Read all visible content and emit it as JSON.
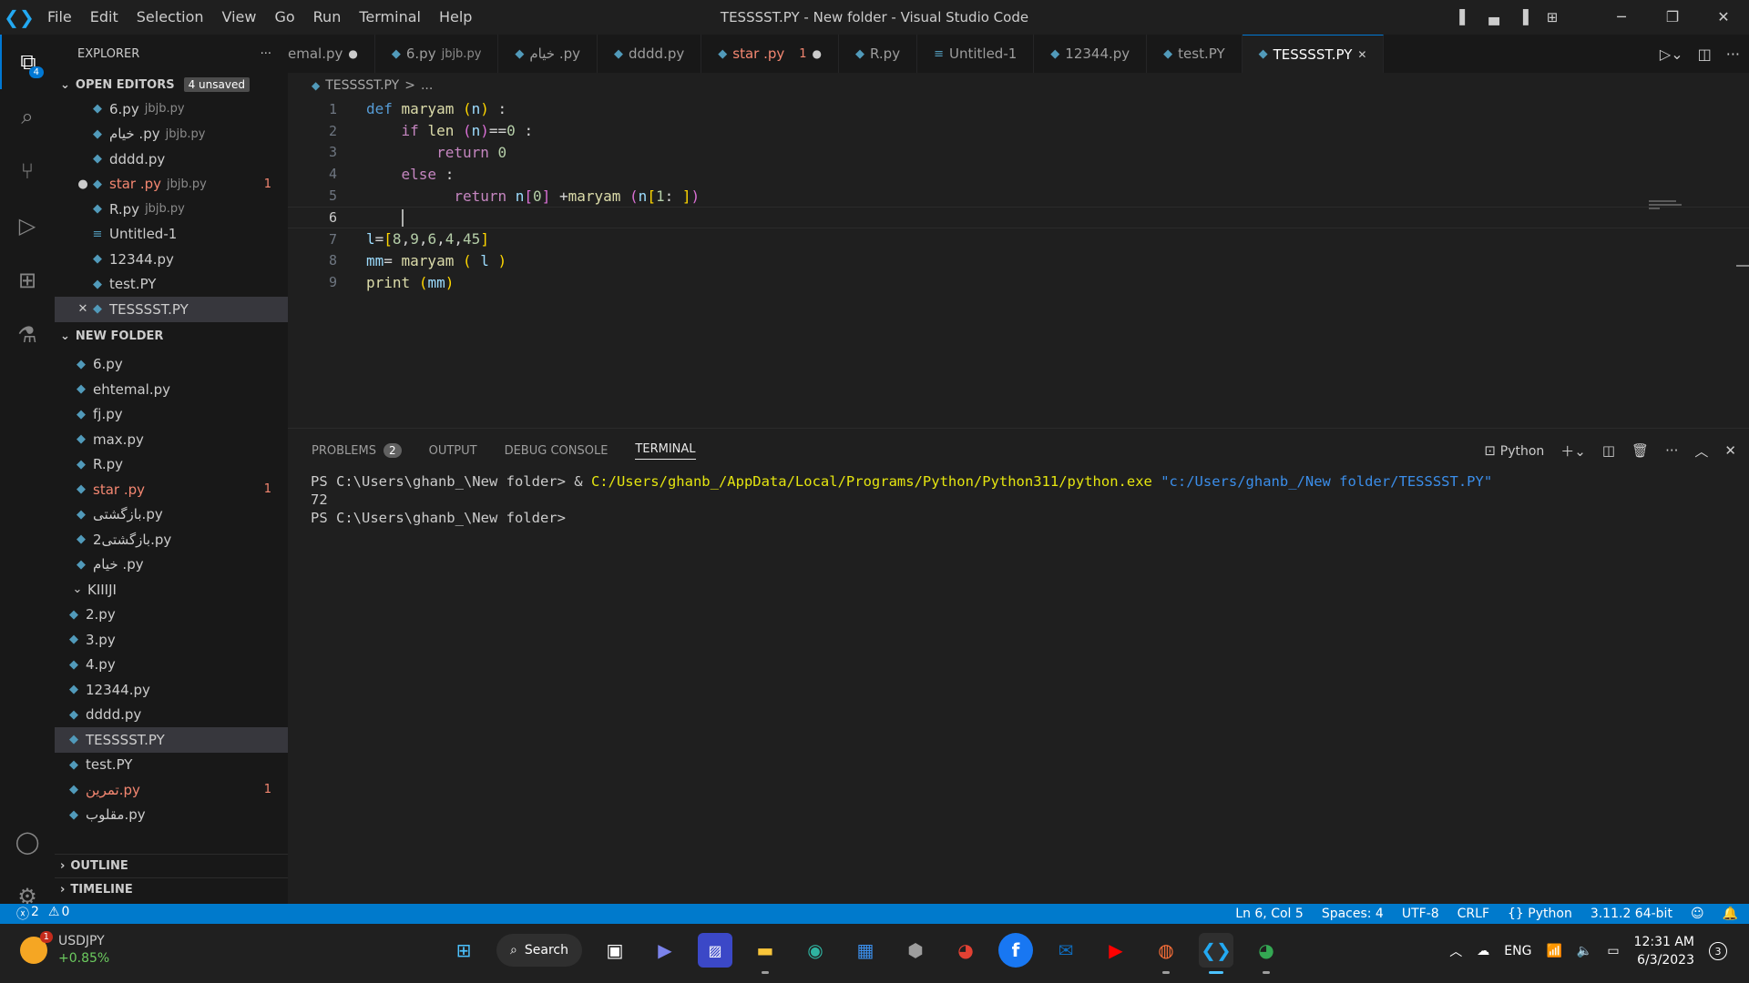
{
  "window": {
    "title": "TESSSST.PY - New folder - Visual Studio Code",
    "menu": [
      "File",
      "Edit",
      "Selection",
      "View",
      "Go",
      "Run",
      "Terminal",
      "Help"
    ]
  },
  "activity_bar": {
    "explorer_badge": "4",
    "items": [
      "files-icon",
      "search-icon",
      "source-control-icon",
      "run-debug-icon",
      "extensions-icon",
      "testing-icon"
    ],
    "bottom": [
      "account-icon",
      "settings-gear-icon"
    ]
  },
  "explorer": {
    "title": "EXPLORER",
    "more": "···",
    "open_editors": {
      "label": "OPEN EDITORS",
      "unsaved": "4 unsaved",
      "items": [
        {
          "name": "6.py",
          "desc": "jbjb.py"
        },
        {
          "name": "خیام .py",
          "desc": "jbjb.py"
        },
        {
          "name": "dddd.py",
          "desc": ""
        },
        {
          "name": "star .py",
          "desc": "jbjb.py",
          "errors": "1"
        },
        {
          "name": "R.py",
          "desc": "jbjb.py"
        },
        {
          "name": "Untitled-1",
          "desc": ""
        },
        {
          "name": "12344.py",
          "desc": ""
        },
        {
          "name": "test.PY",
          "desc": ""
        },
        {
          "name": "TESSSST.PY",
          "desc": ""
        }
      ]
    },
    "folder": {
      "label": "NEW FOLDER",
      "files": [
        {
          "name": "6.py"
        },
        {
          "name": "ehtemal.py"
        },
        {
          "name": "fj.py"
        },
        {
          "name": "max.py"
        },
        {
          "name": "R.py"
        },
        {
          "name": "star .py",
          "errors": "1"
        },
        {
          "name": "بازگشتی.py"
        },
        {
          "name": "بازگشتی2.py"
        },
        {
          "name": "خیام .py"
        }
      ],
      "subfolder": "KIIIJI",
      "sub_files": [
        {
          "name": "2.py"
        },
        {
          "name": "3.py"
        },
        {
          "name": "4.py"
        },
        {
          "name": "12344.py"
        },
        {
          "name": "dddd.py"
        },
        {
          "name": "TESSSST.PY"
        },
        {
          "name": "test.PY"
        },
        {
          "name": "تمرین.py",
          "errors": "1"
        },
        {
          "name": "مقلوب.py"
        }
      ]
    },
    "outline": "OUTLINE",
    "timeline": "TIMELINE"
  },
  "tabs": [
    {
      "name": "emal.py",
      "mark": "●"
    },
    {
      "name": "6.py",
      "desc": "jbjb.py"
    },
    {
      "name": "خیام .py"
    },
    {
      "name": "dddd.py"
    },
    {
      "name": "star .py",
      "errors": "1",
      "mark": "●"
    },
    {
      "name": "R.py"
    },
    {
      "name": "Untitled-1"
    },
    {
      "name": "12344.py"
    },
    {
      "name": "test.PY"
    },
    {
      "name": "TESSSST.PY",
      "mark": "✕"
    }
  ],
  "breadcrumb": {
    "file": "TESSSST.PY",
    "sep": ">",
    "rest": "..."
  },
  "editor": {
    "line_numbers": [
      "1",
      "2",
      "3",
      "4",
      "5",
      "6",
      "7",
      "8",
      "9"
    ]
  },
  "panel": {
    "tabs": [
      "PROBLEMS",
      "OUTPUT",
      "DEBUG CONSOLE",
      "TERMINAL"
    ],
    "problems_count": "2",
    "shell": "Python",
    "terminal": {
      "prompt1": "PS C:\\Users\\ghanb_\\New folder> ",
      "amp": "& ",
      "exe": "C:/Users/ghanb_/AppData/Local/Programs/Python/Python311/python.exe",
      "arg": "\"c:/Users/ghanb_/New folder/TESSSST.PY\"",
      "output": "72",
      "prompt2": "PS C:\\Users\\ghanb_\\New folder>"
    }
  },
  "statusbar": {
    "errors": "2",
    "warnings": "0",
    "position": "Ln 6, Col 5",
    "spaces": "Spaces: 4",
    "encoding": "UTF-8",
    "eol": "CRLF",
    "language": "Python",
    "interpreter": "3.11.2 64-bit"
  },
  "taskbar": {
    "weather_badge": "1",
    "ticker": "USDJPY",
    "change": "+0.85%",
    "search": "Search",
    "lang": "ENG",
    "time": "12:31 AM",
    "date": "6/3/2023",
    "notifications": "3"
  }
}
